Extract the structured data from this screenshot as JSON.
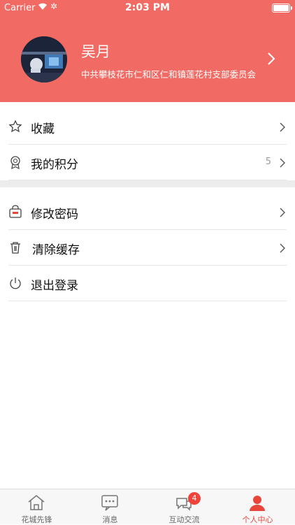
{
  "status_bar": {
    "carrier": "Carrier",
    "time": "2:03 PM"
  },
  "profile": {
    "name": "吴月",
    "org": "中共攀枝花市仁和区仁和镇莲花村支部委员会"
  },
  "menu": {
    "items": [
      {
        "label": "收藏",
        "icon": "star-icon"
      },
      {
        "label": "我的积分",
        "value": "5",
        "icon": "medal-icon"
      },
      {
        "label": "修改密码",
        "icon": "password-icon"
      },
      {
        "label": "清除缓存",
        "icon": "trash-icon"
      },
      {
        "label": "退出登录",
        "icon": "power-icon"
      }
    ]
  },
  "tabbar": {
    "tabs": [
      {
        "label": "花城先锋",
        "icon": "home-icon"
      },
      {
        "label": "消息",
        "icon": "message-icon"
      },
      {
        "label": "互动交流",
        "icon": "chat-icon",
        "badge": "4"
      },
      {
        "label": "个人中心",
        "icon": "person-icon",
        "active": true
      }
    ]
  },
  "colors": {
    "accent": "#f16a63",
    "active_tab": "#e8453c",
    "badge": "#f0443b"
  }
}
